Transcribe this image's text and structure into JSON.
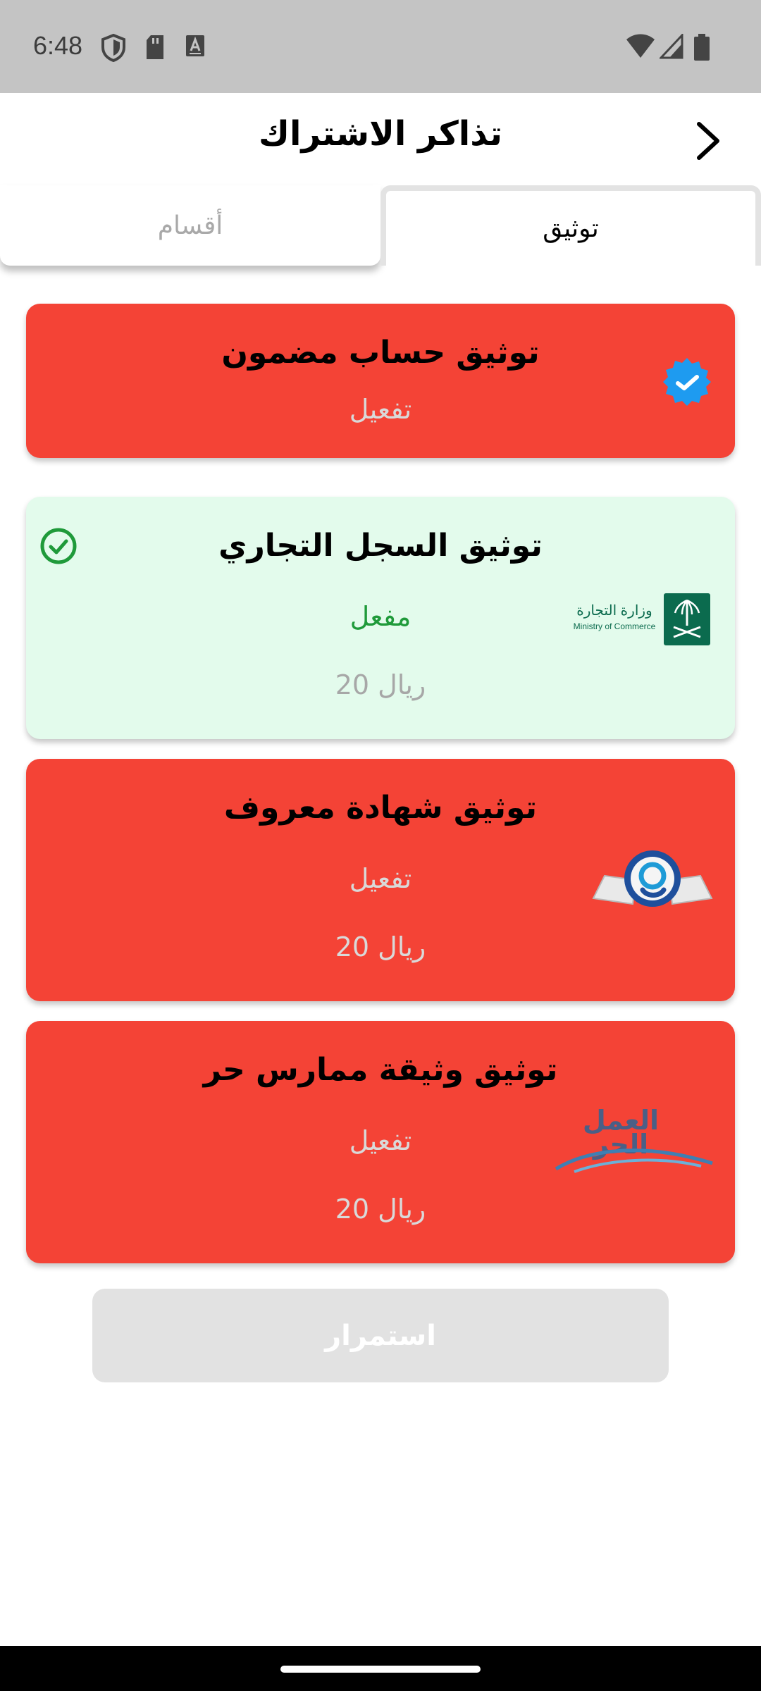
{
  "status_bar": {
    "time": "6:48",
    "icons": [
      "shield-icon",
      "sd-card-icon",
      "a-box-icon",
      "wifi-icon",
      "signal-icon",
      "battery-icon"
    ]
  },
  "header": {
    "title": "تذاكر الاشتراك",
    "back_icon": "chevron-right-icon"
  },
  "tabs": [
    {
      "label": "أقسام",
      "selected": false
    },
    {
      "label": "توثيق",
      "selected": true
    }
  ],
  "cards": [
    {
      "title": "توثيق حساب مضمون",
      "status": "تفعيل",
      "price": "",
      "state": "inactive",
      "logo": "verified-badge-icon"
    },
    {
      "title": "توثيق السجل التجاري",
      "status": "مفعل",
      "price": "20 ريال",
      "state": "active",
      "logo": "ministry-of-commerce-logo",
      "logo_text_ar": "وزارة التجارة",
      "logo_text_en": "Ministry of Commerce",
      "check_icon": "check-circle-icon"
    },
    {
      "title": "توثيق شهادة معروف",
      "status": "تفعيل",
      "price": "20 ريال",
      "state": "inactive",
      "logo": "maroof-logo"
    },
    {
      "title": "توثيق وثيقة ممارس حر",
      "status": "تفعيل",
      "price": "20 ريال",
      "state": "inactive",
      "logo": "freelance-logo",
      "logo_text_ar_top": "العمل",
      "logo_text_ar_bottom": "الحر"
    }
  ],
  "continue_button": {
    "label": "استمرار",
    "enabled": false
  },
  "colors": {
    "inactive_card": "#f44336",
    "active_card": "#e3fbec",
    "active_status": "#1f9a3a",
    "status_bar": "#c4c4c4",
    "disabled_button": "#e2e2e2"
  }
}
